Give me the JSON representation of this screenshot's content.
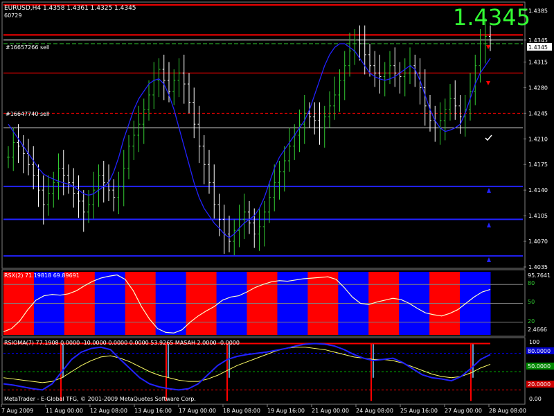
{
  "main": {
    "header": "EURUSD,H4  1.4358 1.4361 1.4325 1.4345",
    "id_label": "60729",
    "big_price": "1.4345",
    "price_tag": "1.4345",
    "order_labels": [
      "#16657266 sell",
      "#16647740 sell"
    ],
    "axis_labels": [
      "1.4385",
      "1.4345",
      "1.4315",
      "1.4280",
      "1.4245",
      "1.4210",
      "1.4175",
      "1.4140",
      "1.4105",
      "1.4070",
      "1.4035"
    ],
    "colors": {
      "bull": "#32cd32",
      "bear": "#ffffff",
      "ma": "#2222ff",
      "alert_red": "#ff0000",
      "bg": "#000000"
    }
  },
  "rsx": {
    "header": "RSX(2) 71.19818 69.89691",
    "axis_labels": [
      "95.7641",
      "2.4666"
    ],
    "level_labels": [
      "80",
      "50",
      "20"
    ]
  },
  "rsioma": {
    "header": "RSIOMA(7) 77.1908 0.0000 -10.0000 0.0000 0.0000 53.9265  MASAH 2.0000 -0.0000",
    "axis_labels": [
      "100",
      "0.00"
    ],
    "level_labels": [
      "80.0000",
      "50.0000",
      "20.0000"
    ]
  },
  "footer": "MetaTrader - E-Global TFG, © 2001-2009 MetaQuotes Software Corp.",
  "time_axis": [
    "7 Aug 2009",
    "11 Aug 00:00",
    "12 Aug 08:00",
    "13 Aug 16:00",
    "17 Aug 00:00",
    "18 Aug 08:00",
    "19 Aug 16:00",
    "21 Aug 00:00",
    "24 Aug 08:00",
    "25 Aug 16:00",
    "27 Aug 00:00",
    "28 Aug 08:00"
  ],
  "chart_data": {
    "type": "candlestick",
    "series": {
      "price_closes": [
        1.4185,
        1.4205,
        1.42,
        1.419,
        1.4175,
        1.416,
        1.414,
        1.412,
        1.4135,
        1.415,
        1.417,
        1.416,
        1.415,
        1.4135,
        1.4125,
        1.411,
        1.412,
        1.414,
        1.416,
        1.415,
        1.414,
        1.413,
        1.4145,
        1.417,
        1.42,
        1.4215,
        1.423,
        1.425,
        1.427,
        1.429,
        1.4305,
        1.429,
        1.4275,
        1.429,
        1.43,
        1.4285,
        1.426,
        1.423,
        1.42,
        1.4175,
        1.415,
        1.412,
        1.41,
        1.408,
        1.407,
        1.4085,
        1.41,
        1.411,
        1.4095,
        1.408,
        1.409,
        1.411,
        1.413,
        1.415,
        1.4165,
        1.418,
        1.42,
        1.4215,
        1.423,
        1.4245,
        1.424,
        1.4235,
        1.4225,
        1.424,
        1.4255,
        1.427,
        1.429,
        1.431,
        1.433,
        1.4345,
        1.434,
        1.4325,
        1.431,
        1.43,
        1.4295,
        1.43,
        1.431,
        1.43,
        1.4295,
        1.43,
        1.431,
        1.43,
        1.428,
        1.4255,
        1.4235,
        1.4225,
        1.4235,
        1.425,
        1.4265,
        1.4255,
        1.424,
        1.425,
        1.4275,
        1.431,
        1.434,
        1.435,
        1.4345
      ],
      "moving_average": [
        1.423,
        1.422,
        1.421,
        1.42,
        1.419,
        1.418,
        1.417,
        1.4162,
        1.4158,
        1.4155,
        1.4152,
        1.415,
        1.4148,
        1.4145,
        1.414,
        1.4135,
        1.4133,
        1.4135,
        1.414,
        1.4145,
        1.415,
        1.4165,
        1.4185,
        1.421,
        1.423,
        1.425,
        1.4265,
        1.4275,
        1.4285,
        1.429,
        1.4292,
        1.4285,
        1.427,
        1.425,
        1.4225,
        1.42,
        1.4175,
        1.415,
        1.413,
        1.4115,
        1.4105,
        1.4095,
        1.4088,
        1.408,
        1.4075,
        1.408,
        1.4088,
        1.4095,
        1.41,
        1.4105,
        1.4115,
        1.413,
        1.415,
        1.417,
        1.4185,
        1.4195,
        1.4205,
        1.4215,
        1.4225,
        1.4235,
        1.425,
        1.427,
        1.429,
        1.431,
        1.4325,
        1.4335,
        1.434,
        1.434,
        1.4335,
        1.433,
        1.432,
        1.431,
        1.43,
        1.4295,
        1.4292,
        1.429,
        1.4292,
        1.4295,
        1.43,
        1.4305,
        1.431,
        1.4305,
        1.429,
        1.427,
        1.425,
        1.4235,
        1.4225,
        1.422,
        1.4222,
        1.4225,
        1.423,
        1.4245,
        1.4265,
        1.4285,
        1.43,
        1.431,
        1.432
      ],
      "levels": [
        {
          "value": 1.4393,
          "color": "#ff0000"
        },
        {
          "value": 1.4352,
          "color": "#ff0000"
        },
        {
          "value": 1.4345,
          "color": "#ffffff"
        },
        {
          "value": 1.434,
          "color": "#32cd32"
        },
        {
          "value": 1.43,
          "color": "#ff0000"
        },
        {
          "value": 1.4245,
          "color": "#ff0000"
        },
        {
          "value": 1.4225,
          "color": "#ffffff"
        },
        {
          "value": 1.4145,
          "color": "#2222ff"
        },
        {
          "value": 1.41,
          "color": "#2222ff"
        },
        {
          "value": 1.405,
          "color": "#2222ff"
        }
      ],
      "rsx_values": [
        5,
        10,
        22,
        40,
        55,
        62,
        64,
        63,
        65,
        70,
        78,
        85,
        90,
        93,
        95,
        88,
        70,
        45,
        25,
        10,
        4,
        3,
        8,
        20,
        30,
        38,
        45,
        55,
        60,
        62,
        68,
        75,
        80,
        84,
        86,
        85,
        87,
        89,
        90,
        91,
        92,
        88,
        75,
        60,
        50,
        48,
        52,
        55,
        58,
        56,
        50,
        42,
        35,
        32,
        30,
        34,
        40,
        50,
        60,
        68,
        72
      ],
      "rsx_regime": [
        "red",
        "blue",
        "red",
        "blue",
        "red",
        "blue",
        "red",
        "blue",
        "red",
        "blue",
        "red",
        "blue",
        "red",
        "blue",
        "red",
        "blue"
      ],
      "rsioma_line": [
        30,
        28,
        25,
        22,
        20,
        30,
        50,
        70,
        82,
        88,
        90,
        86,
        70,
        55,
        40,
        30,
        25,
        22,
        20,
        22,
        30,
        45,
        60,
        70,
        75,
        78,
        80,
        82,
        85,
        88,
        92,
        95,
        96,
        95,
        92,
        86,
        78,
        72,
        68,
        70,
        72,
        65,
        55,
        45,
        40,
        38,
        35,
        42,
        55,
        70,
        78
      ],
      "rsioma_ma": [
        40,
        38,
        36,
        34,
        32,
        34,
        40,
        50,
        60,
        68,
        74,
        76,
        72,
        66,
        58,
        50,
        44,
        40,
        36,
        34,
        34,
        38,
        44,
        52,
        60,
        66,
        72,
        78,
        84,
        88,
        90,
        90,
        88,
        86,
        82,
        78,
        74,
        72,
        70,
        70,
        68,
        64,
        58,
        52,
        46,
        42,
        40,
        42,
        48,
        56,
        62
      ],
      "y_range_price": [
        1.4035,
        1.4395
      ]
    }
  }
}
